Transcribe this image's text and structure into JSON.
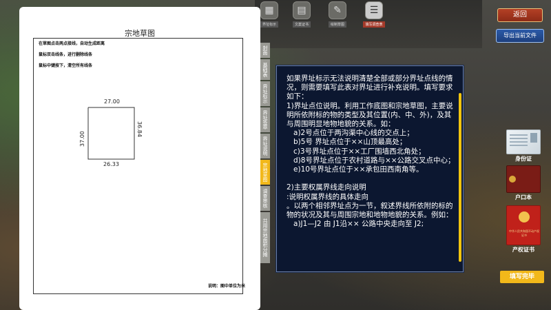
{
  "toolbar": {
    "items": [
      {
        "label": "界址标示",
        "icon": "map-icon"
      },
      {
        "label": "文案证书",
        "icon": "certificate-icon"
      },
      {
        "label": "绘制草图",
        "icon": "draw-icon"
      },
      {
        "label": "填写调查表",
        "icon": "form-icon",
        "active": true
      }
    ]
  },
  "sketch": {
    "title": "宗地草图",
    "instructions": [
      "在草图点击两点接线，自动生成距离",
      "鼠标双击线条，进行删除线条",
      "鼠标中键按下，清空所有线条"
    ],
    "note": "说明：图中单位为米",
    "edges": {
      "top": "27.00",
      "left": "37.00",
      "right": "36.84",
      "bottom": "26.33"
    }
  },
  "tabs": [
    {
      "label": "封面",
      "active": false
    },
    {
      "label": "基础表",
      "active": false
    },
    {
      "label": "界址标示",
      "active": false
    },
    {
      "label": "界址签章",
      "active": false
    },
    {
      "label": "界址说明",
      "active": false
    },
    {
      "label": "宗地草图",
      "active": true
    },
    {
      "label": "调查审核",
      "active": false
    },
    {
      "label": "共用宗地面积分摊",
      "active": false
    }
  ],
  "info_panel": {
    "text": "如果界址标示无法说明清楚全部或部分界址点线的情况，则需要填写此表对界址进行补充说明。填写要求如下：\n1)界址点位说明。利用工作底图和宗地草图，主要说明所依附标的物的类型及其位置(内、中、外)，及其与周围明显地物地貌的关系。如：\n   a)2号点位于两沟渠中心线的交点上；\n   b)5号 界址点位于××山顶最高处；\n   c)3号界址点位于××工厂围墙西北角处；\n   d)8号界址点位于农村道路与××公路交叉点中心；\n   e)10号界址点位于××承包田西南角等。\n\n2)主要权属界线走向说明\n:说明权属界线的具体走向\n。以两个相邻界址点为一节，叙述界线所依附的标的物的状况及其与周围宗地和地物地貌的关系。例如：\n   a)J1—J2 由 J1沿×× 公路中央走向至 J2;"
  },
  "buttons": {
    "back": "返回",
    "export": "导出当前文件",
    "done": "填写完毕"
  },
  "documents": [
    {
      "label": "身份证",
      "icon": "id-card-icon"
    },
    {
      "label": "户口本",
      "icon": "household-register-icon"
    },
    {
      "label": "产权证书",
      "icon": "property-certificate-icon",
      "cover_text": "中华人民共和国不动产权证书"
    }
  ],
  "colors": {
    "panel_bg": "#0c1730",
    "accent_yellow": "#f2b81a",
    "back_red": "#b34025",
    "export_blue": "#2b5aa8"
  }
}
